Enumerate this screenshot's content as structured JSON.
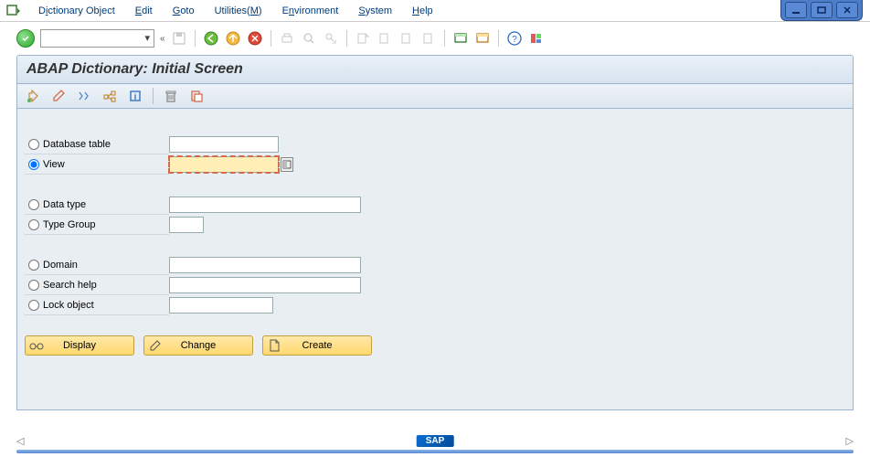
{
  "menu": {
    "items": [
      {
        "pre": "D",
        "ul": "i",
        "post": "ctionary Object"
      },
      {
        "pre": "",
        "ul": "E",
        "post": "dit"
      },
      {
        "pre": "",
        "ul": "G",
        "post": "oto"
      },
      {
        "pre": "Utilities(",
        "ul": "M",
        "post": ")"
      },
      {
        "pre": "E",
        "ul": "n",
        "post": "vironment"
      },
      {
        "pre": "",
        "ul": "S",
        "post": "ystem"
      },
      {
        "pre": "",
        "ul": "H",
        "post": "elp"
      }
    ]
  },
  "title": "ABAP Dictionary: Initial Screen",
  "radios": {
    "db_table": "Database table",
    "view": "View",
    "data_type": "Data type",
    "type_group": "Type Group",
    "domain": "Domain",
    "search_help": "Search help",
    "lock_object": "Lock object"
  },
  "inputs": {
    "db_table": "",
    "view": "",
    "data_type": "",
    "type_group": "",
    "domain": "",
    "search_help": "",
    "lock_object": ""
  },
  "selected_radio": "view",
  "buttons": {
    "display": "Display",
    "change": "Change",
    "create": "Create"
  },
  "footer": {
    "logo": "SAP"
  }
}
